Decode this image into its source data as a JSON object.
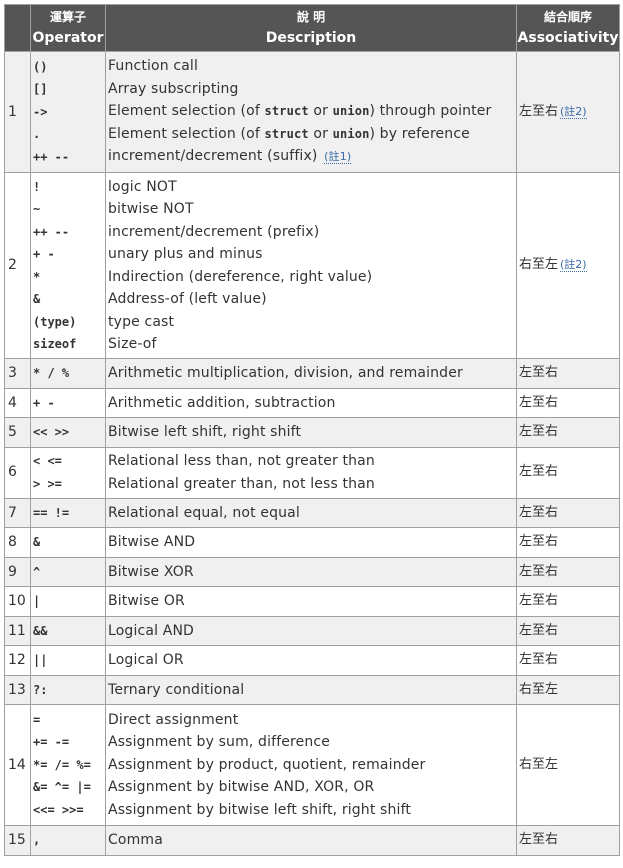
{
  "header": {
    "col1": "",
    "col2_zh": "運算子",
    "col2_en": "Operator",
    "col3_zh": "說 明",
    "col3_en": "Description",
    "col4_zh": "結合順序",
    "col4_en": "Associativity"
  },
  "rows": [
    {
      "num": "1",
      "ops": [
        "()",
        "[]",
        "->",
        ".",
        "++ --"
      ],
      "desc": {
        "d0": "Function call",
        "d1": "Array subscripting",
        "d2a": "Element selection (of ",
        "d2b": "struct",
        "d2c": " or ",
        "d2d": "union",
        "d2e": ") through pointer",
        "d3a": "Element selection (of ",
        "d3b": "struct",
        "d3c": " or ",
        "d3d": "union",
        "d3e": ") by reference",
        "d4": "increment/decrement (suffix)",
        "d4note": "(註1)"
      },
      "assoc": "左至右",
      "assoc_note": "(註2)"
    },
    {
      "num": "2",
      "ops": [
        "!",
        "~",
        "++ --",
        "+ -",
        "*",
        "&",
        "(type)",
        "sizeof"
      ],
      "desc": [
        "logic NOT",
        "bitwise NOT",
        "increment/decrement (prefix)",
        "unary plus and minus",
        "Indirection (dereference, right value)",
        "Address-of (left value)",
        "type cast",
        "Size-of"
      ],
      "assoc": "右至左",
      "assoc_note": "(註2)"
    },
    {
      "num": "3",
      "ops": [
        "* / %"
      ],
      "desc": [
        "Arithmetic multiplication, division, and remainder"
      ],
      "assoc": "左至右"
    },
    {
      "num": "4",
      "ops": [
        "+ -"
      ],
      "desc": [
        "Arithmetic addition, subtraction"
      ],
      "assoc": "左至右"
    },
    {
      "num": "5",
      "ops": [
        "<< >>"
      ],
      "desc": [
        "Bitwise left shift, right shift"
      ],
      "assoc": "左至右"
    },
    {
      "num": "6",
      "ops": [
        "< <=",
        "> >="
      ],
      "desc": [
        "Relational less than, not greater than",
        "Relational greater than, not less than"
      ],
      "assoc": "左至右"
    },
    {
      "num": "7",
      "ops": [
        "== !="
      ],
      "desc": [
        "Relational equal, not equal"
      ],
      "assoc": "左至右"
    },
    {
      "num": "8",
      "ops": [
        "&"
      ],
      "desc": [
        "Bitwise AND"
      ],
      "assoc": "左至右"
    },
    {
      "num": "9",
      "ops": [
        "^"
      ],
      "desc": [
        "Bitwise XOR"
      ],
      "assoc": "左至右"
    },
    {
      "num": "10",
      "ops": [
        "|"
      ],
      "desc": [
        "Bitwise OR"
      ],
      "assoc": "左至右"
    },
    {
      "num": "11",
      "ops": [
        "&&"
      ],
      "desc": [
        "Logical AND"
      ],
      "assoc": "左至右"
    },
    {
      "num": "12",
      "ops": [
        "||"
      ],
      "desc": [
        "Logical OR"
      ],
      "assoc": "左至右"
    },
    {
      "num": "13",
      "ops": [
        "?:"
      ],
      "desc": [
        "Ternary conditional"
      ],
      "assoc": "右至左"
    },
    {
      "num": "14",
      "ops": [
        "=",
        "+= -=",
        "*= /= %=",
        "&= ^= |=",
        "<<= >>="
      ],
      "desc": [
        "Direct assignment",
        "Assignment by sum, difference",
        "Assignment by product, quotient, remainder",
        "Assignment by bitwise AND, XOR, OR",
        "Assignment by bitwise left shift, right shift"
      ],
      "assoc": "右至左"
    },
    {
      "num": "15",
      "ops": [
        ","
      ],
      "desc": [
        "Comma"
      ],
      "assoc": "左至右"
    }
  ]
}
